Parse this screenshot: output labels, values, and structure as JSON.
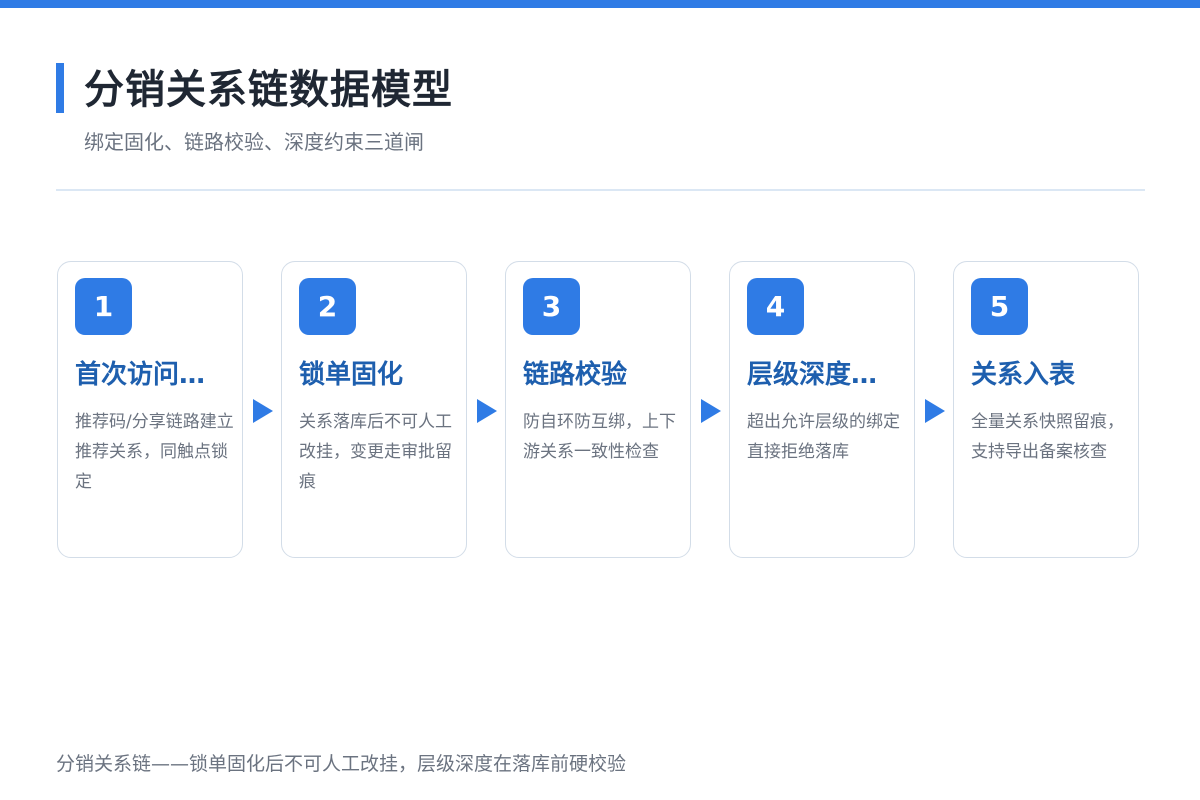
{
  "header": {
    "title": "分销关系链数据模型",
    "subtitle": "绑定固化、链路校验、深度约束三道闸"
  },
  "steps": [
    {
      "number": "1",
      "title": "首次访问…",
      "description": "推荐码/分享链路建立推荐关系，同触点锁定"
    },
    {
      "number": "2",
      "title": "锁单固化",
      "description": "关系落库后不可人工改挂，变更走审批留痕"
    },
    {
      "number": "3",
      "title": "链路校验",
      "description": "防自环防互绑，上下游关系一致性检查"
    },
    {
      "number": "4",
      "title": "层级深度…",
      "description": "超出允许层级的绑定直接拒绝落库"
    },
    {
      "number": "5",
      "title": "关系入表",
      "description": "全量关系快照留痕，支持导出备案核查"
    }
  ],
  "footer": {
    "note": "分销关系链——锁单固化后不可人工改挂，层级深度在落库前硬校验"
  },
  "colors": {
    "accent": "#2f7be5",
    "title_text": "#1f2733",
    "step_title": "#1e5fae",
    "muted_text": "#6b7380",
    "card_border": "#d3dde8"
  }
}
